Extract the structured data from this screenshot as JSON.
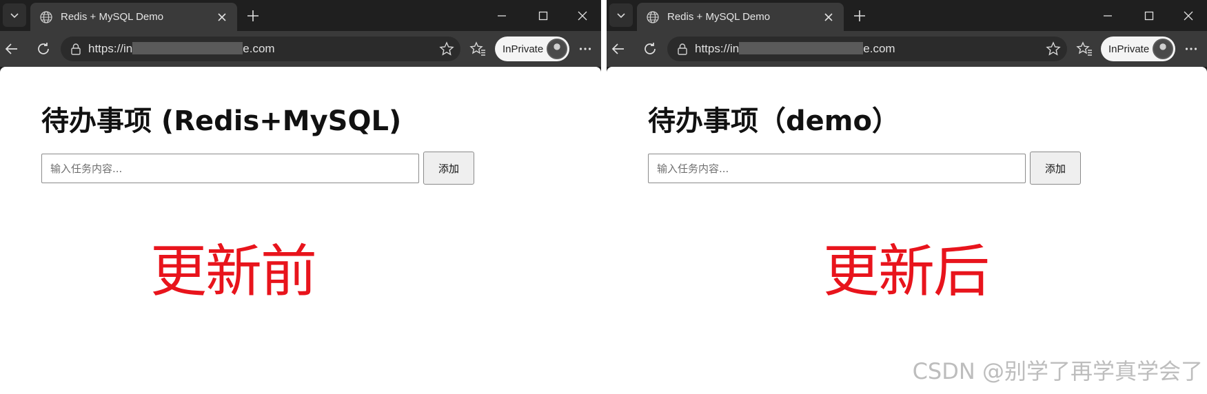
{
  "left": {
    "tab_title": "Redis + MySQL Demo",
    "url_prefix": "https://in",
    "url_suffix": "e.com",
    "inprivate_label": "InPrivate",
    "heading": "待办事项 (Redis+MySQL)",
    "input_placeholder": "输入任务内容...",
    "add_button_label": "添加",
    "annotation": "更新前"
  },
  "right": {
    "tab_title": "Redis + MySQL Demo",
    "url_prefix": "https://in",
    "url_suffix": "e.com",
    "inprivate_label": "InPrivate",
    "heading": "待办事项（demo）",
    "input_placeholder": "输入任务内容...",
    "add_button_label": "添加",
    "annotation": "更新后"
  },
  "watermark": "CSDN @别学了再学真学会了",
  "colors": {
    "annotation_red": "#e8141c",
    "chrome_dark": "#1f1f1f",
    "toolbar_gray": "#3a3a3a"
  }
}
